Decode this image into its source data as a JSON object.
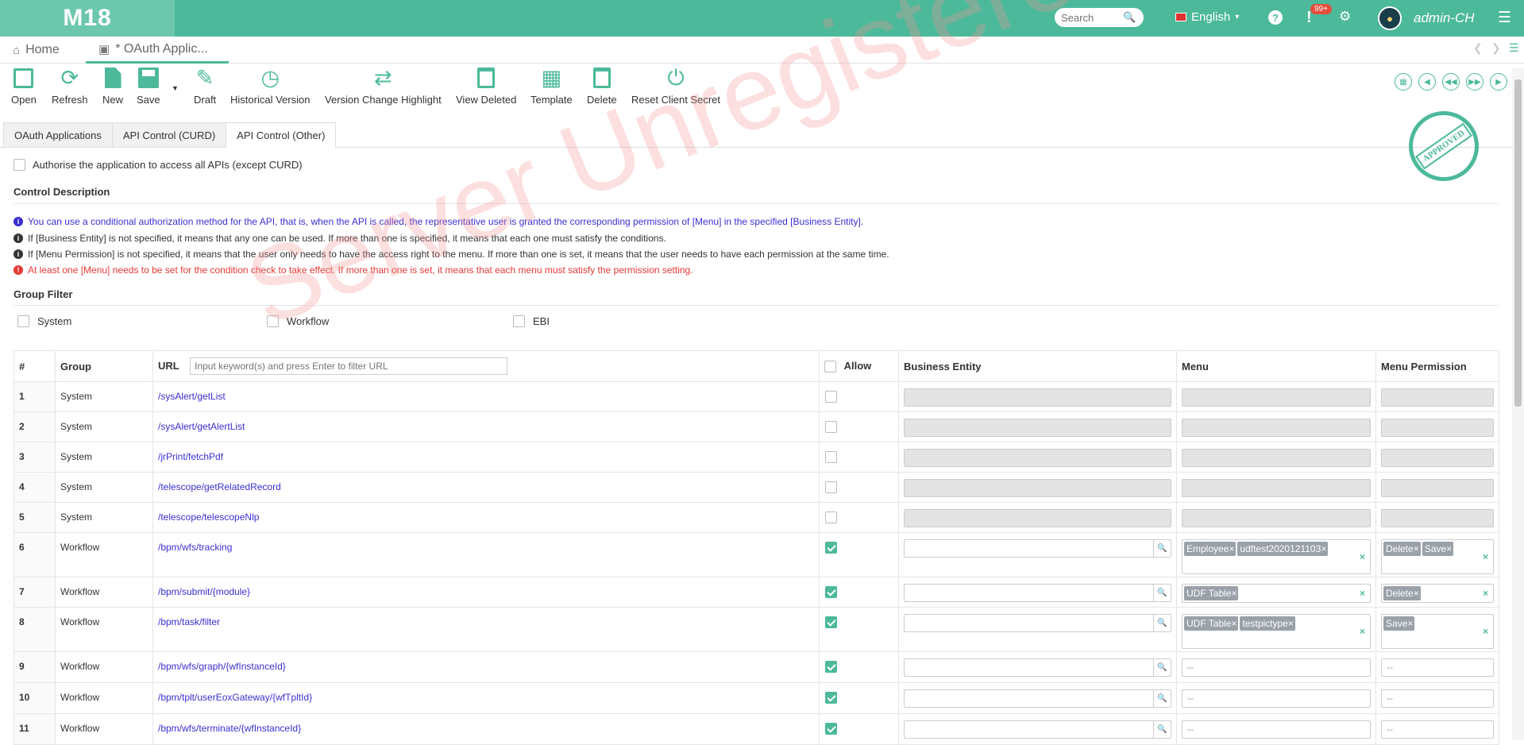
{
  "app": {
    "logo": "M18"
  },
  "topbar": {
    "search_placeholder": "Search",
    "language": "English",
    "help": "?",
    "alert_icon": "!",
    "notification_badge": "99+",
    "username": "admin-CH"
  },
  "tabs": [
    {
      "label": "Home"
    },
    {
      "label": "* OAuth Applic..."
    }
  ],
  "toolbar": {
    "open": "Open",
    "refresh": "Refresh",
    "new": "New",
    "save": "Save",
    "draft": "Draft",
    "historical": "Historical Version",
    "highlight": "Version Change Highlight",
    "view_deleted": "View Deleted",
    "template": "Template",
    "delete": "Delete",
    "reset_secret": "Reset Client Secret"
  },
  "form_tabs": [
    "OAuth Applications",
    "API Control (CURD)",
    "API Control (Other)"
  ],
  "stamp": "APPROVED",
  "watermark": "Server Unregistered",
  "authorise_label": "Authorise the application to access all APIs (except CURD)",
  "control_description": {
    "title": "Control Description",
    "notes": [
      {
        "text": "You can use a conditional authorization method for the API, that is, when the API is called, the representative user is granted the corresponding permission of [Menu] in the specified [Business Entity].",
        "color": "#3b2fd0"
      },
      {
        "text": "If [Business Entity] is not specified, it means that any one can be used. If more than one is specified, it means that each one must satisfy the conditions.",
        "color": "#333333"
      },
      {
        "text": "If [Menu Permission] is not specified, it means that the user only needs to have the access right to the menu. If more than one is set, it means that the user needs to have each permission at the same time.",
        "color": "#333333"
      },
      {
        "text": "At least one [Menu] needs to be set for the condition check to take effect. If more than one is set, it means that each menu must satisfy the permission setting.",
        "color": "#e53935"
      }
    ]
  },
  "group_filter": {
    "title": "Group Filter",
    "options": [
      "System",
      "Workflow",
      "EBI"
    ]
  },
  "table": {
    "headers": {
      "num": "#",
      "group": "Group",
      "url": "URL",
      "allow": "Allow",
      "entity": "Business Entity",
      "menu": "Menu",
      "perm": "Menu Permission"
    },
    "filter_placeholder": "Input keyword(s) and press Enter to filter URL",
    "rows": [
      {
        "num": "1",
        "group": "System",
        "url": "/sysAlert/getList",
        "allow": false,
        "menu": [],
        "perm": []
      },
      {
        "num": "2",
        "group": "System",
        "url": "/sysAlert/getAlertList",
        "allow": false,
        "menu": [],
        "perm": []
      },
      {
        "num": "3",
        "group": "System",
        "url": "/jrPrint/fetchPdf",
        "allow": false,
        "menu": [],
        "perm": []
      },
      {
        "num": "4",
        "group": "System",
        "url": "/telescope/getRelatedRecord",
        "allow": false,
        "menu": [],
        "perm": []
      },
      {
        "num": "5",
        "group": "System",
        "url": "/telescope/telescopeNlp",
        "allow": false,
        "menu": [],
        "perm": []
      },
      {
        "num": "6",
        "group": "Workflow",
        "url": "/bpm/wfs/tracking",
        "allow": true,
        "menu": [
          "Employee",
          "udftest2020121103"
        ],
        "perm": [
          "Delete",
          "Save"
        ]
      },
      {
        "num": "7",
        "group": "Workflow",
        "url": "/bpm/submit/{module}",
        "allow": true,
        "menu": [
          "UDF Table"
        ],
        "perm": [
          "Delete"
        ]
      },
      {
        "num": "8",
        "group": "Workflow",
        "url": "/bpm/task/filter",
        "allow": true,
        "menu": [
          "UDF Table",
          "testpictype"
        ],
        "perm": [
          "Save"
        ]
      },
      {
        "num": "9",
        "group": "Workflow",
        "url": "/bpm/wfs/graph/{wfInstanceId}",
        "allow": true,
        "menu": "--",
        "perm": "--"
      },
      {
        "num": "10",
        "group": "Workflow",
        "url": "/bpm/tplt/userEoxGateway/{wfTpltId}",
        "allow": true,
        "menu": "--",
        "perm": "--"
      },
      {
        "num": "11",
        "group": "Workflow",
        "url": "/bpm/wfs/terminate/{wfInstanceId}",
        "allow": true,
        "menu": "--",
        "perm": "--"
      }
    ]
  }
}
